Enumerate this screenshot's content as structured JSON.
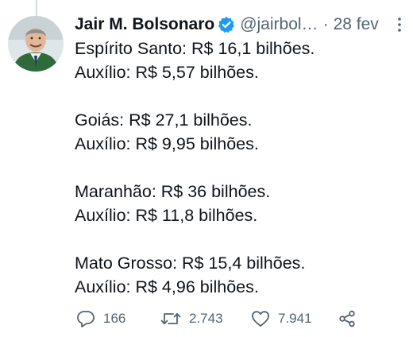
{
  "tweet": {
    "author": {
      "name": "Jair M. Bolsonaro",
      "handle": "@jairbol…",
      "verified": true,
      "avatar_icon": "profile-photo"
    },
    "separator": "·",
    "timestamp": "28 fev",
    "lines": [
      "Espírito Santo: R$ 16,1 bilhões.",
      "Auxílio: R$ 5,57 bilhões.",
      "",
      "Goiás: R$ 27,1 bilhões.",
      "Auxílio: R$ 9,95 bilhões.",
      "",
      "Maranhão: R$ 36 bilhões.",
      "Auxílio: R$ 11,8 bilhões.",
      "",
      "Mato Grosso: R$ 15,4 bilhões.",
      "Auxílio: R$ 4,96 bilhões."
    ],
    "actions": {
      "reply_count": "166",
      "retweet_count": "2.743",
      "like_count": "7.941"
    }
  },
  "colors": {
    "text": "#0f1419",
    "secondary": "#536471",
    "verified": "#1d9bf0"
  }
}
